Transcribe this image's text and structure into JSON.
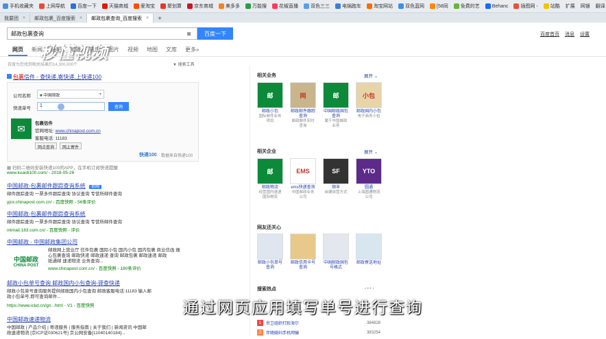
{
  "bookmarks": [
    {
      "label": "手机收藏夹",
      "color": "#4a90d9"
    },
    {
      "label": "上网导航",
      "color": "#e94b3c"
    },
    {
      "label": "百度一下",
      "color": "#2e6fd9"
    },
    {
      "label": "天猫商城",
      "color": "#d81e06"
    },
    {
      "label": "爱淘宝",
      "color": "#ff5000"
    },
    {
      "label": "聚划算",
      "color": "#e23a2e"
    },
    {
      "label": "京东商城",
      "color": "#c81623"
    },
    {
      "label": "美多多",
      "color": "#f58220"
    },
    {
      "label": "万能搜",
      "color": "#2a9d4a"
    },
    {
      "label": "花椒直播",
      "color": "#ff3b5c"
    },
    {
      "label": "双色三三",
      "color": "#5aa0e6"
    },
    {
      "label": "电锅跑车",
      "color": "#3b7ddd"
    },
    {
      "label": "淘宝网站",
      "color": "#ff6a00"
    },
    {
      "label": "双色蓝网",
      "color": "#3f8ee8"
    },
    {
      "label": "[58同",
      "color": "#ff8800"
    },
    {
      "label": "免费的艺",
      "color": "#6cb33e"
    },
    {
      "label": "Behanc",
      "color": "#1769ff"
    },
    {
      "label": "插图网 -",
      "color": "#e5533d"
    },
    {
      "label": "站酷",
      "color": "#f4c400"
    }
  ],
  "bookmarks_right": [
    "扩展",
    "网银",
    "翻译",
    "截图"
  ],
  "tabs": [
    {
      "label": "我要团",
      "active": false
    },
    {
      "label": "邮政包裹_百度搜索",
      "active": false
    },
    {
      "label": "邮政包裹查询_百度搜索",
      "active": true
    }
  ],
  "search": {
    "query": "邮政包裹查询",
    "button": "百度一下"
  },
  "watermark": "秒懂视频",
  "header_links": [
    "百度首页",
    "消息",
    "设置"
  ],
  "nav_tabs": [
    "网页",
    "新闻",
    "贴吧",
    "知道",
    "音乐",
    "图片",
    "视频",
    "地图",
    "文库",
    "更多»"
  ],
  "stats": "百度为您找到相关结果约14,300,000个",
  "tools": "搜索工具",
  "result1": {
    "title_pre": "包裹",
    "title_rest": "信件 - 查快递,寄快递,上快递100",
    "company_label": "公司名称",
    "company_value": "中国邮政",
    "number_label": "快递单号",
    "number_value": "1",
    "query_button": "查询",
    "brand": "包裹信件",
    "site_label": "官网地址:",
    "site_value": "www.chinapost.com.cn",
    "phone_label": "客服电话:",
    "phone_value": "11183",
    "btn1": "网点查询",
    "btn2": "网上寄件",
    "kuaidi": "快递100",
    "kuaidi_sub": "数据来自快递100",
    "footer": "扫码二维码安装快递100的APP，在手机订阅快递提醒",
    "url": "www.kuaidi100.com/ - 2018-05-26"
  },
  "result2": {
    "title": "中国邮政-包裹邮件跟踪查询系统",
    "badge": "官网",
    "snip": "邮件跟踪查询 一票多件跟踪查询 协议查询 专营所邮件查询",
    "url": "yjcx.chinapost.com.cn/ - 百度快照 - 56条评价"
  },
  "result3": {
    "title": "中国邮政-包裹邮件跟踪查询系统",
    "snip": "邮件跟踪查询 一票多件跟踪查询 协议查询 专营所邮件查询",
    "url": "intmail.183.com.cn/ - 百度快照 - 评价"
  },
  "result4": {
    "title": "中国邮政 - 中国邮政集团公司",
    "logo_cn": "中国邮政",
    "logo_en": "CHINA POST",
    "snip1": "邮政网上营业厅 信件包裹 国际小包 国内小包 国内包裹 商业信函 报",
    "snip2": "心包裹查询 邮政快递 邮政速递 查询 邮政包裹 邮政速递 邮政",
    "snip3": "纸通邮 速递物流 业务查询...",
    "url": "www.chinapost.com.cn/ - 百度快照 - 180条评价"
  },
  "result5": {
    "title": "邮政小包单号查询 邮政国内小包查询-驿查快递",
    "snip1": "邮政小包单号查询服务提供邮政国内小包查询 邮政客服电话:11183 输入邮",
    "snip2": "政小包单号,即可查询邮件...",
    "url": "https://www.ickd.cn/gn...html - V1 - 百度快照"
  },
  "result6": {
    "title": "中国邮政速递物流",
    "snip1": "中国邮政 | 产品介绍 | 寄递服务 | 服务指南 | 关于我们 | 新闻资讯 中国邮",
    "snip2": "政速递物流 [京ICP证030621号] 京公网安备[11040140184]..."
  },
  "side": {
    "biz_title": "相关业务",
    "biz_more": "展开",
    "biz": [
      {
        "name": "邮政小包",
        "desc": "国际邮件业务项目",
        "img": "邮",
        "bg": "#0c8a3a"
      },
      {
        "name": "邮政邮件跟踪查询",
        "desc": "邮政邮件实时查询",
        "img": "网",
        "bg": "#c9b58c"
      },
      {
        "name": "中国邮政国包查询",
        "desc": "属于中国邮政业务",
        "img": "邮",
        "bg": "#0c8a3a"
      },
      {
        "name": "邮政国内小包",
        "desc": "电子商务小包",
        "img": "小包",
        "bg": "#e7d4a8"
      }
    ],
    "ent_title": "相关企业",
    "ent_more": "展开",
    "ent": [
      {
        "name": "邮政物流",
        "desc": "经营国内速递国际物流",
        "img": "邮",
        "bg": "#0c8a3a"
      },
      {
        "name": "ems快递查询",
        "desc": "中国邮政业务公司",
        "img": "EMS",
        "bg": "#ffffff"
      },
      {
        "name": "顺丰",
        "desc": "自建自营方式",
        "img": "SF",
        "bg": "#333333"
      },
      {
        "name": "圆通",
        "desc": "上海圆通物流公司",
        "img": "YTO",
        "bg": "#5c2b8a"
      }
    ],
    "care_title": "网友还关心",
    "care": [
      {
        "name": "邮政小包单号查询",
        "bg": "#dfe6f0"
      },
      {
        "name": "邮政信用卡号查询",
        "bg": "#e8c98a"
      },
      {
        "name": "中国邮政国包号格式",
        "bg": "#e3e8ee"
      },
      {
        "name": "邮政寄送地址",
        "bg": "#d8e6f0"
      }
    ],
    "hot_title": "搜索热点",
    "hot": [
      {
        "rank": "1",
        "text": "世卫组织打脸海尔",
        "count": "384828",
        "color": "#f54545"
      },
      {
        "rank": "2",
        "text": "伴随媳妇手机网骗",
        "count": "383254",
        "color": "#ff8547"
      }
    ]
  },
  "caption": "通过网页应用填写单号进行查询"
}
